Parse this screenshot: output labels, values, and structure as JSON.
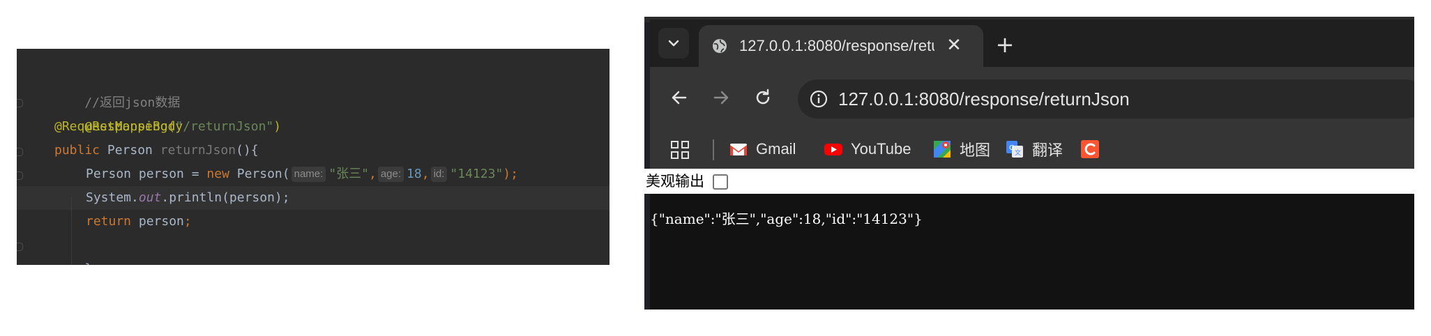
{
  "editor": {
    "line1": {
      "comment": "//返回json数据"
    },
    "line2": {
      "annotation": "@ResponseBody"
    },
    "line3": {
      "annotation": "@RequestMapping(",
      "string": "\"/returnJson\"",
      "close": ")"
    },
    "line4": {
      "kw": "public",
      "type": " Person ",
      "method": "returnJson",
      "rest": "(){"
    },
    "line5": {
      "type": "Person person = ",
      "kw": "new",
      "ctor": " Person(",
      "hint_name": "name:",
      "str_name": "\"张三\"",
      "comma1": ",",
      "hint_age": "age:",
      "num_age": "18",
      "comma2": ",",
      "hint_id": "id:",
      "str_id": "\"14123\"",
      "end": ");"
    },
    "line6": {
      "obj": "System.",
      "field": "out",
      "call": ".println(person);"
    },
    "line7": {
      "kw": "return",
      "rest": " person",
      "semi": ";"
    },
    "line8": {
      "brace": "}"
    }
  },
  "browser": {
    "tab": {
      "title": "127.0.0.1:8080/response/retu",
      "close_glyph": "✕",
      "new_tab_glyph": "+"
    },
    "omnibox": {
      "url": "127.0.0.1:8080/response/returnJson"
    },
    "bookmarks": [
      {
        "label": "Gmail",
        "icon": "gmail-icon"
      },
      {
        "label": "YouTube",
        "icon": "youtube-icon"
      },
      {
        "label": "地图",
        "icon": "maps-icon"
      },
      {
        "label": "翻译",
        "icon": "translate-icon"
      },
      {
        "label": "",
        "icon": "c-icon"
      }
    ],
    "pretty_print": {
      "label": "美观输出",
      "checked": false
    },
    "body_text": "{\"name\":\"张三\",\"age\":18,\"id\":\"14123\"}"
  },
  "colors": {
    "editor_bg": "#2b2b2b",
    "browser_bg": "#202124",
    "content_bg": "#121212",
    "annotation": "#bbb529",
    "keyword": "#cc7832",
    "string": "#6a8759",
    "number": "#6897bb"
  }
}
